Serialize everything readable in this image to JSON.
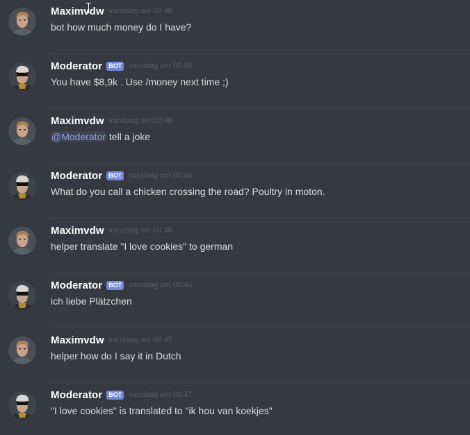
{
  "messages": [
    {
      "author": "Maximvdw",
      "bot": false,
      "bot_label": "",
      "timestamp": "vandaag om 00:46",
      "mention": "",
      "text": "bot how much money do I have?"
    },
    {
      "author": "Moderator",
      "bot": true,
      "bot_label": "BOT",
      "timestamp": "vandaag om 00:46",
      "mention": "",
      "text": "You have $8,9k . Use /money next time ;)"
    },
    {
      "author": "Maximvdw",
      "bot": false,
      "bot_label": "",
      "timestamp": "vandaag om 00:46",
      "mention": "@Moderator",
      "text": " tell a joke"
    },
    {
      "author": "Moderator",
      "bot": true,
      "bot_label": "BOT",
      "timestamp": "vandaag om 00:46",
      "mention": "",
      "text": "What do you call a chicken crossing the road? Poultry in moton."
    },
    {
      "author": "Maximvdw",
      "bot": false,
      "bot_label": "",
      "timestamp": "vandaag om 00:46",
      "mention": "",
      "text": "helper translate \"I love cookies\" to german"
    },
    {
      "author": "Moderator",
      "bot": true,
      "bot_label": "BOT",
      "timestamp": "vandaag om 00:46",
      "mention": "",
      "text": "ich liebe Plätzchen"
    },
    {
      "author": "Maximvdw",
      "bot": false,
      "bot_label": "",
      "timestamp": "vandaag om 00:47",
      "mention": "",
      "text": "helper how do I say it in Dutch"
    },
    {
      "author": "Moderator",
      "bot": true,
      "bot_label": "BOT",
      "timestamp": "vandaag om 00:47",
      "mention": "",
      "text": "\"I love cookies\" is translated to \"ik hou van koekjes\""
    }
  ],
  "colors": {
    "background": "#36393f",
    "username": "#ffffff",
    "bot_tag": "#7289da",
    "timestamp": "#5b5e64",
    "text": "#dcddde",
    "mention": "#8ea1e1"
  },
  "icons": {
    "user_avatar": "avatar-photo-icon",
    "bot_avatar": "avatar-photo-sunglasses-icon",
    "cursor": "text-cursor-icon"
  }
}
